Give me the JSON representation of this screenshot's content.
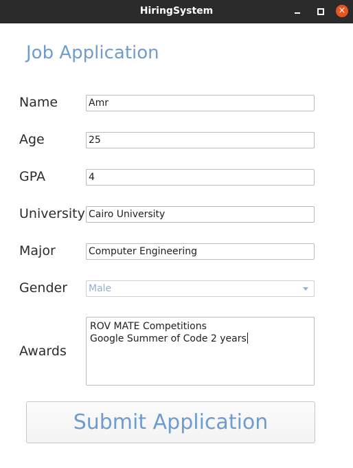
{
  "window": {
    "title": "HiringSystem",
    "controls": {
      "minimize": "minimize-icon",
      "maximize": "maximize-icon",
      "close": "close-icon",
      "close_glyph": "×"
    },
    "accent": "#e95420"
  },
  "form": {
    "heading": "Job Application",
    "fields": {
      "name": {
        "label": "Name",
        "value": "Amr"
      },
      "age": {
        "label": "Age",
        "value": "25"
      },
      "gpa": {
        "label": "GPA",
        "value": "4"
      },
      "university": {
        "label": "University",
        "value": "Cairo University"
      },
      "major": {
        "label": "Major",
        "value": "Computer Engineering"
      },
      "gender": {
        "label": "Gender",
        "selected": "Male"
      },
      "awards": {
        "label": "Awards",
        "lines": [
          "ROV MATE Competitions",
          "Google Summer of Code 2 years"
        ]
      }
    },
    "submit_label": "Submit Application",
    "colors": {
      "heading": "#6f9cce",
      "label": "#2b2b2b"
    }
  }
}
